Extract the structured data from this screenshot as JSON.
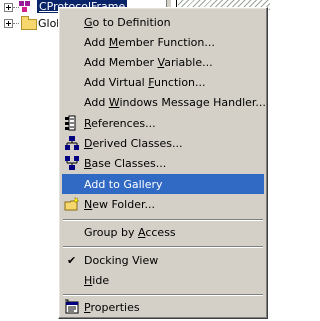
{
  "tree": {
    "items": [
      {
        "label": "CProtocolFrame",
        "icon": "class-icon",
        "selected": true
      },
      {
        "label": "Glob",
        "icon": "folder-icon",
        "selected": false
      }
    ]
  },
  "context_menu": {
    "items": [
      {
        "parts": [
          "",
          "G",
          "o to Definition"
        ],
        "icon": null
      },
      {
        "parts": [
          "Add ",
          "M",
          "ember Function..."
        ],
        "icon": null
      },
      {
        "parts": [
          "Add Member ",
          "V",
          "ariable..."
        ],
        "icon": null
      },
      {
        "parts": [
          "Add Virtual ",
          "F",
          "unction..."
        ],
        "icon": null
      },
      {
        "parts": [
          "Add ",
          "W",
          "indows Message Handler..."
        ],
        "icon": null
      },
      {
        "parts": [
          "",
          "R",
          "eferences..."
        ],
        "icon": "references-icon"
      },
      {
        "parts": [
          "",
          "D",
          "erived Classes..."
        ],
        "icon": "derived-classes-icon"
      },
      {
        "parts": [
          "",
          "B",
          "ase Classes..."
        ],
        "icon": "base-classes-icon"
      },
      {
        "parts": [
          "Add to Gallery",
          "",
          ""
        ],
        "icon": null,
        "highlighted": true
      },
      {
        "parts": [
          "",
          "N",
          "ew Folder..."
        ],
        "icon": "new-folder-icon"
      },
      {
        "parts": [
          "Group by ",
          "A",
          "ccess"
        ],
        "icon": null
      },
      {
        "parts": [
          "Docking View",
          "",
          ""
        ],
        "icon": "checkmark-icon",
        "checked": true
      },
      {
        "parts": [
          "",
          "H",
          "ide"
        ],
        "icon": null
      },
      {
        "parts": [
          "",
          "P",
          "roperties"
        ],
        "icon": "properties-icon"
      }
    ]
  },
  "colors": {
    "menu_bg": "#d4d0c8",
    "highlight": "#316ac5",
    "selection": "#0a246a"
  }
}
